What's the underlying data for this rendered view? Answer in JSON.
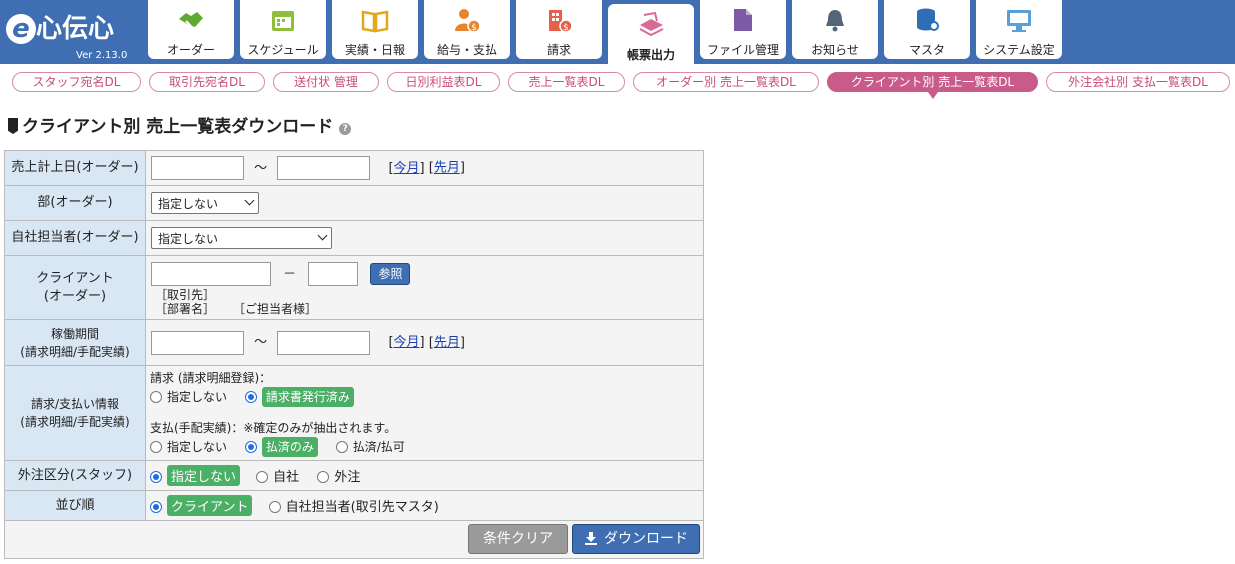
{
  "app": {
    "logo": "心伝心",
    "version": "Ver 2.13.0"
  },
  "tabs": [
    {
      "label": "オーダー"
    },
    {
      "label": "スケジュール"
    },
    {
      "label": "実績・日報"
    },
    {
      "label": "給与・支払"
    },
    {
      "label": "請求"
    },
    {
      "label": "帳票出力"
    },
    {
      "label": "ファイル管理"
    },
    {
      "label": "お知らせ"
    },
    {
      "label": "マスタ"
    },
    {
      "label": "システム設定"
    }
  ],
  "subnav": [
    {
      "label": "スタッフ宛名DL"
    },
    {
      "label": "取引先宛名DL"
    },
    {
      "label": "送付状 管理"
    },
    {
      "label": "日別利益表DL"
    },
    {
      "label": "売上一覧表DL"
    },
    {
      "label": "オーダー別 売上一覧表DL"
    },
    {
      "label": "クライアント別 売上一覧表DL"
    },
    {
      "label": "外注会社別 支払一覧表DL"
    }
  ],
  "page": {
    "title": "クライアント別 売上一覧表ダウンロード"
  },
  "form": {
    "sales_date": {
      "label": "売上計上日(オーダー)",
      "tilde": "～",
      "this_month": "今月",
      "last_month": "先月"
    },
    "dept": {
      "label": "部(オーダー)",
      "value": "指定しない"
    },
    "staff": {
      "label": "自社担当者(オーダー)",
      "value": "指定しない"
    },
    "client": {
      "label1": "クライアント",
      "label2": "(オーダー)",
      "dash": "－",
      "ref": "参照",
      "hint1": "［取引先］",
      "hint2": "［部署名］",
      "hint3": "［ご担当者様］"
    },
    "period": {
      "label1": "稼働期間",
      "label2": "(請求明細/手配実績)",
      "tilde": "～",
      "this_month": "今月",
      "last_month": "先月"
    },
    "billing": {
      "label1": "請求/支払い情報",
      "label2": "(請求明細/手配実績)",
      "invoice_head": "請求 (請求明細登録)：",
      "inv_opt1": "指定しない",
      "inv_opt2": "請求書発行済み",
      "pay_head": "支払(手配実績)：※確定のみが抽出されます。",
      "pay_opt1": "指定しない",
      "pay_opt2": "払済のみ",
      "pay_opt3": "払済/払可"
    },
    "outsource": {
      "label": "外注区分(スタッフ)",
      "opt1": "指定しない",
      "opt2": "自社",
      "opt3": "外注"
    },
    "sort": {
      "label": "並び順",
      "opt1": "クライアント",
      "opt2": "自社担当者(取引先マスタ)"
    }
  },
  "buttons": {
    "clear": "条件クリア",
    "download": "ダウンロード"
  },
  "colors": {
    "header": "#3f6fb2",
    "accent": "#c95b8a",
    "label_bg": "#d9e6f4",
    "badge": "#4caf66"
  }
}
